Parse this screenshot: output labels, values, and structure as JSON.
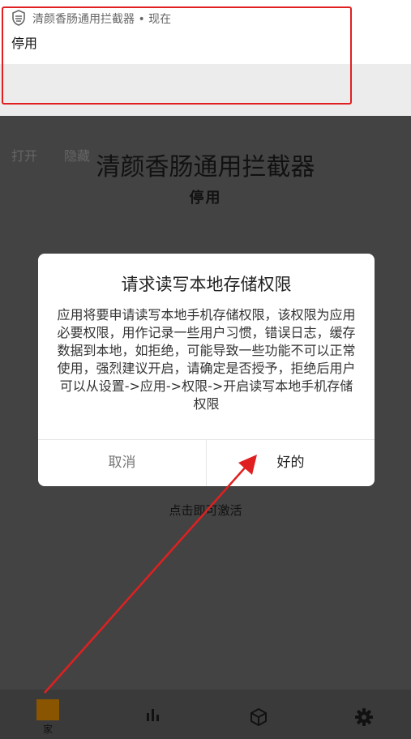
{
  "notification": {
    "app_name": "清颜香肠通用拦截器",
    "separator": "•",
    "time": "现在",
    "status": "停用",
    "actions": [
      "打开",
      "隐藏"
    ]
  },
  "main": {
    "title": "清颜香肠通用拦截器",
    "status": "停用",
    "activate_hint": "点击即可激活"
  },
  "dialog": {
    "title": "请求读写本地存储权限",
    "body": "应用将要申请读写本地手机存储权限，该权限为应用必要权限，用作记录一些用户习惯，错误日志，缓存数据到本地，如拒绝，可能导致一些功能不可以正常使用，强烈建议开启，请确定是否授予，拒绝后用户可以从设置->应用->权限->开启读写本地手机存储权限",
    "cancel_label": "取消",
    "ok_label": "好的"
  },
  "bottom_nav": {
    "items": [
      {
        "label": "家",
        "icon": "home-icon"
      },
      {
        "label": "",
        "icon": "bar-chart-icon"
      },
      {
        "label": "",
        "icon": "cube-icon"
      },
      {
        "label": "",
        "icon": "gear-icon"
      }
    ]
  },
  "colors": {
    "annotation": "#e02020",
    "home_accent": "#8a5500",
    "overlay": "#434343"
  }
}
